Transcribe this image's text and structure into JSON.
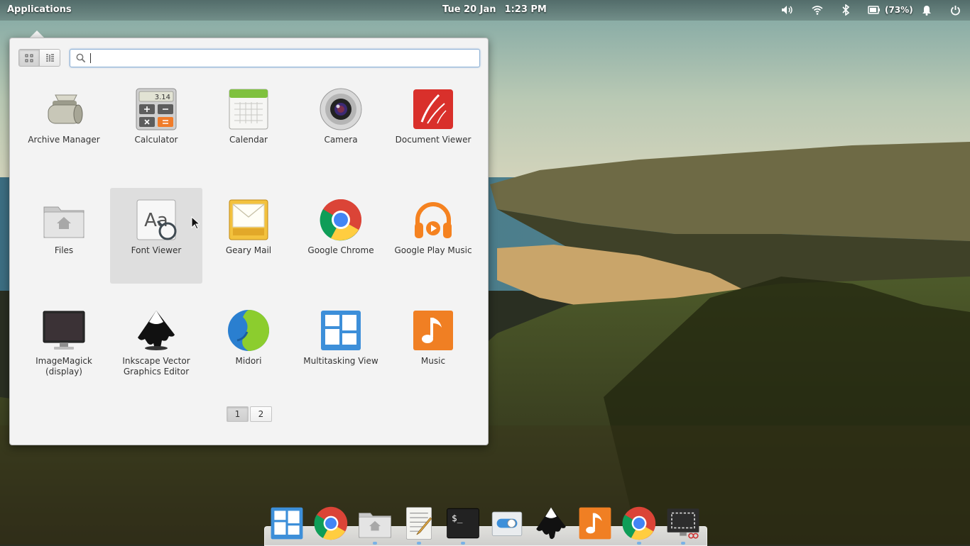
{
  "panel": {
    "applications_label": "Applications",
    "date": "Tue 20 Jan",
    "time": "1:23 PM",
    "battery_label": "(73%)",
    "indicators": [
      "volume-icon",
      "wifi-icon",
      "bluetooth-icon",
      "battery-icon",
      "notifications-icon",
      "power-icon"
    ]
  },
  "launcher": {
    "search": {
      "value": "",
      "placeholder": ""
    },
    "view_modes": [
      "grid-view",
      "category-view"
    ],
    "apps": [
      {
        "label": "Archive Manager",
        "icon": "archive-manager-icon"
      },
      {
        "label": "Calculator",
        "icon": "calculator-icon",
        "display": "3.14"
      },
      {
        "label": "Calendar",
        "icon": "calendar-icon"
      },
      {
        "label": "Camera",
        "icon": "camera-icon"
      },
      {
        "label": "Document Viewer",
        "icon": "document-viewer-icon"
      },
      {
        "label": "Files",
        "icon": "files-icon"
      },
      {
        "label": "Font Viewer",
        "icon": "font-viewer-icon",
        "glyph": "Aa"
      },
      {
        "label": "Geary Mail",
        "icon": "geary-mail-icon"
      },
      {
        "label": "Google Chrome",
        "icon": "chrome-icon"
      },
      {
        "label": "Google Play Music",
        "icon": "play-music-icon"
      },
      {
        "label": "ImageMagick (display)",
        "icon": "imagemagick-icon"
      },
      {
        "label": "Inkscape Vector Graphics Editor",
        "icon": "inkscape-icon"
      },
      {
        "label": "Midori",
        "icon": "midori-icon"
      },
      {
        "label": "Multitasking View",
        "icon": "multitasking-view-icon"
      },
      {
        "label": "Music",
        "icon": "music-icon"
      }
    ],
    "pages": [
      "1",
      "2"
    ],
    "active_page": "1"
  },
  "dock": {
    "items": [
      "multitasking-view-icon",
      "chrome-icon",
      "files-icon",
      "text-editor-icon",
      "terminal-icon",
      "settings-icon",
      "inkscape-icon",
      "music-icon",
      "chrome-icon",
      "screenshot-icon"
    ],
    "terminal_glyph": "$_"
  },
  "colors": {
    "accent": "#3d8fd9",
    "popover_bg": "#f3f3f3",
    "hover_bg": "#dedede"
  }
}
